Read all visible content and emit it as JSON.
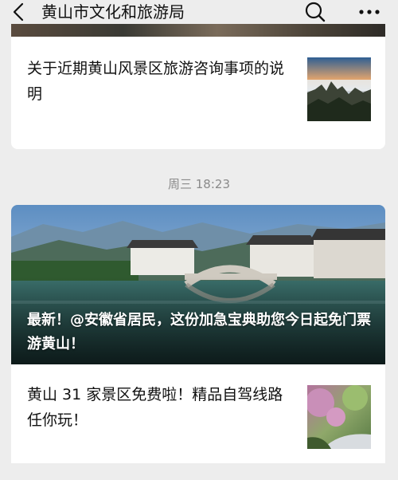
{
  "header": {
    "title": "黄山市文化和旅游局",
    "back_icon": "chevron-left-icon",
    "search_icon": "search-icon",
    "more_icon": "more-dots-icon"
  },
  "article1": {
    "title": "关于近期黄山风景区旅游咨询事项的说明",
    "thumbnail": "mountain-sea-of-clouds-image"
  },
  "timestamp": "周三 18:23",
  "article2": {
    "headline": "最新！@安徽省居民，这份加急宝典助您今日起免门票游黄山！",
    "cover": "ancient-village-arch-bridge-image",
    "sub_title": "黄山 31 家景区免费啦！精品自驾线路任你玩！",
    "sub_thumbnail": "blossom-road-image"
  },
  "colors": {
    "background": "#ededed",
    "card": "#ffffff",
    "text": "#111111",
    "muted": "#8a8a8a"
  }
}
